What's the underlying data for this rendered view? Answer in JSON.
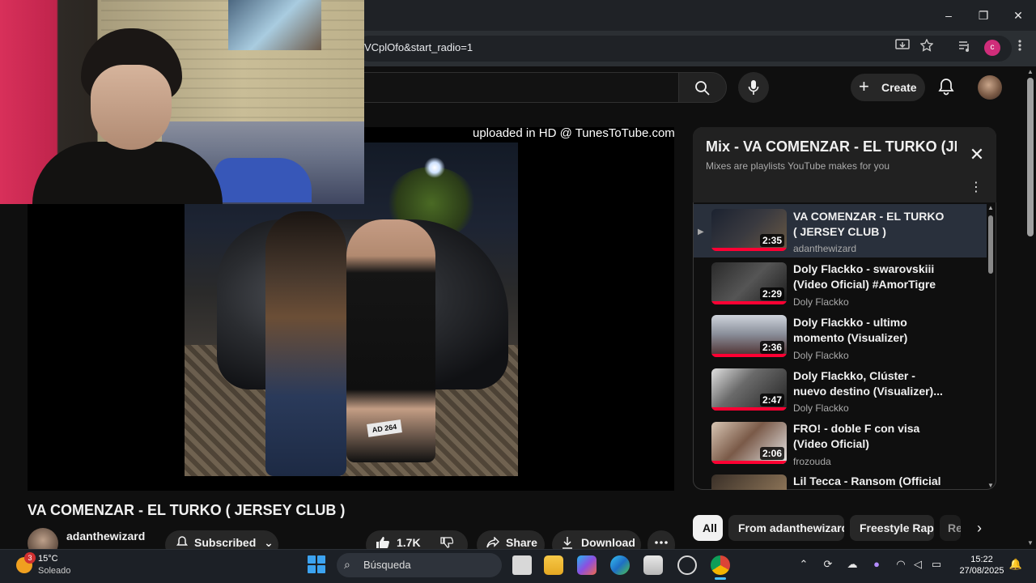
{
  "browser": {
    "url_fragment": "VCplOfo&start_radio=1",
    "profile_initial": "c",
    "window_controls": {
      "minimize": "–",
      "maximize": "❐",
      "close": "✕"
    }
  },
  "youtube": {
    "create_label": "Create"
  },
  "player": {
    "watermark": "uploaded in HD @ TunesToTube.com",
    "plate_text": "AD 264"
  },
  "video": {
    "title": "VA COMENZAR - EL TURKO ( JERSEY CLUB )",
    "channel": "adanthewizard",
    "subscribed_label": "Subscribed",
    "likes": "1.7K",
    "share_label": "Share",
    "download_label": "Download"
  },
  "playlist": {
    "title": "Mix - VA COMENZAR - EL TURKO (JERSEY CLUB )",
    "subtitle": "Mixes are playlists YouTube makes for you",
    "items": [
      {
        "title": "VA COMENZAR - EL TURKO ( JERSEY CLUB )",
        "channel": "adanthewizard",
        "duration": "2:35",
        "active": true
      },
      {
        "title": "Doly Flackko - swarovskiii (Video Oficial) #AmorTigre ❤️ ...",
        "channel": "Doly Flackko",
        "duration": "2:29",
        "active": false
      },
      {
        "title": "Doly Flackko - ultimo momento (Visualizer) #AmorTigre ❤️ 🐅",
        "channel": "Doly Flackko",
        "duration": "2:36",
        "active": false
      },
      {
        "title": "Doly Flackko, Clúster - nuevo destino (Visualizer)...",
        "channel": "Doly Flackko",
        "duration": "2:47",
        "active": false
      },
      {
        "title": "FRO! - doble F con visa (Video Oficial)",
        "channel": "frozouda",
        "duration": "2:06",
        "active": false
      },
      {
        "title": "Lil Tecca - Ransom (Official",
        "channel": "",
        "duration": "",
        "active": false
      }
    ]
  },
  "chips": [
    "All",
    "From adanthewizard",
    "Freestyle Rap",
    "Re"
  ],
  "taskbar": {
    "weather_badge": "3",
    "temperature": "15°C",
    "weather": "Soleado",
    "search_placeholder": "Búsqueda",
    "time": "15:22",
    "date": "27/08/2025"
  },
  "colors": {
    "accent_red": "#ff0033",
    "panel_bg": "#212121",
    "active_row": "#29303c",
    "taskbar_blue": "#4cc2ff"
  }
}
